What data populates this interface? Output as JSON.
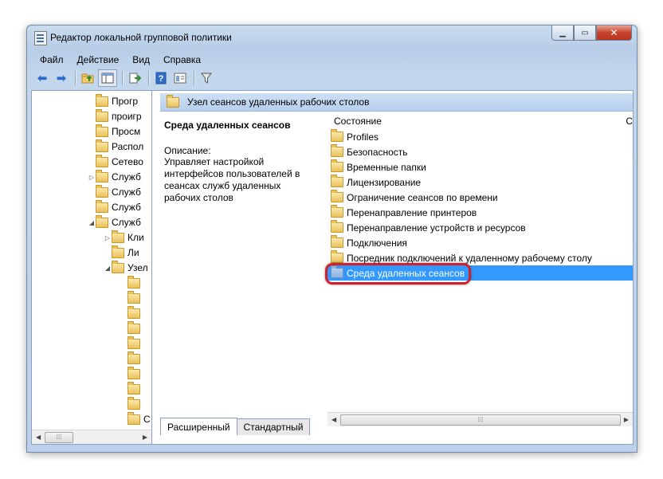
{
  "window": {
    "title": "Редактор локальной групповой политики"
  },
  "menu": [
    {
      "label": "Файл"
    },
    {
      "label": "Действие"
    },
    {
      "label": "Вид"
    },
    {
      "label": "Справка"
    }
  ],
  "tree": {
    "rows": [
      {
        "label": "Прогр",
        "indent": 1,
        "toggle": ""
      },
      {
        "label": "проигр",
        "indent": 1,
        "toggle": ""
      },
      {
        "label": "Просм",
        "indent": 1,
        "toggle": ""
      },
      {
        "label": "Распол",
        "indent": 1,
        "toggle": ""
      },
      {
        "label": "Сетево",
        "indent": 1,
        "toggle": ""
      },
      {
        "label": "Служб",
        "indent": 1,
        "toggle": "collapsed"
      },
      {
        "label": "Служб",
        "indent": 1,
        "toggle": ""
      },
      {
        "label": "Служб",
        "indent": 1,
        "toggle": ""
      },
      {
        "label": "Служб",
        "indent": 1,
        "toggle": "expanded"
      },
      {
        "label": "Кли",
        "indent": 2,
        "toggle": "collapsed"
      },
      {
        "label": "Ли",
        "indent": 2,
        "toggle": ""
      },
      {
        "label": "Узел",
        "indent": 2,
        "toggle": "expanded"
      },
      {
        "label": "",
        "indent": 3,
        "toggle": ""
      },
      {
        "label": "",
        "indent": 3,
        "toggle": ""
      },
      {
        "label": "",
        "indent": 3,
        "toggle": ""
      },
      {
        "label": "",
        "indent": 3,
        "toggle": ""
      },
      {
        "label": "",
        "indent": 3,
        "toggle": ""
      },
      {
        "label": "",
        "indent": 3,
        "toggle": ""
      },
      {
        "label": "",
        "indent": 3,
        "toggle": ""
      },
      {
        "label": "",
        "indent": 3,
        "toggle": ""
      },
      {
        "label": "",
        "indent": 3,
        "toggle": ""
      },
      {
        "label": "С",
        "indent": 3,
        "toggle": ""
      }
    ]
  },
  "header": {
    "title": "Узел сеансов удаленных рабочих столов"
  },
  "description": {
    "title": "Среда удаленных сеансов",
    "label": "Описание:",
    "text": "Управляет настройкой интерфейсов пользователей в сеансах служб удаленных рабочих столов"
  },
  "list": {
    "column_state": "Состояние",
    "column_comment": "С",
    "items": [
      {
        "label": "Profiles"
      },
      {
        "label": "Безопасность"
      },
      {
        "label": "Временные папки"
      },
      {
        "label": "Лицензирование"
      },
      {
        "label": "Ограничение сеансов по времени"
      },
      {
        "label": "Перенаправление принтеров"
      },
      {
        "label": "Перенаправление устройств и ресурсов"
      },
      {
        "label": "Подключения"
      },
      {
        "label": "Посредник подключений к удаленному рабочему столу"
      },
      {
        "label": "Среда удаленных сеансов",
        "selected": true
      }
    ]
  },
  "tabs": [
    {
      "label": "Расширенный"
    },
    {
      "label": "Стандартный"
    }
  ],
  "colors": {
    "selection": "#3399ff",
    "highlight_ring": "#d0202a"
  },
  "icons": [
    "back-arrow-icon",
    "forward-arrow-icon",
    "up-folder-icon",
    "show-tree-icon",
    "export-list-icon",
    "help-icon",
    "properties-icon",
    "filter-icon",
    "folder-icon"
  ]
}
